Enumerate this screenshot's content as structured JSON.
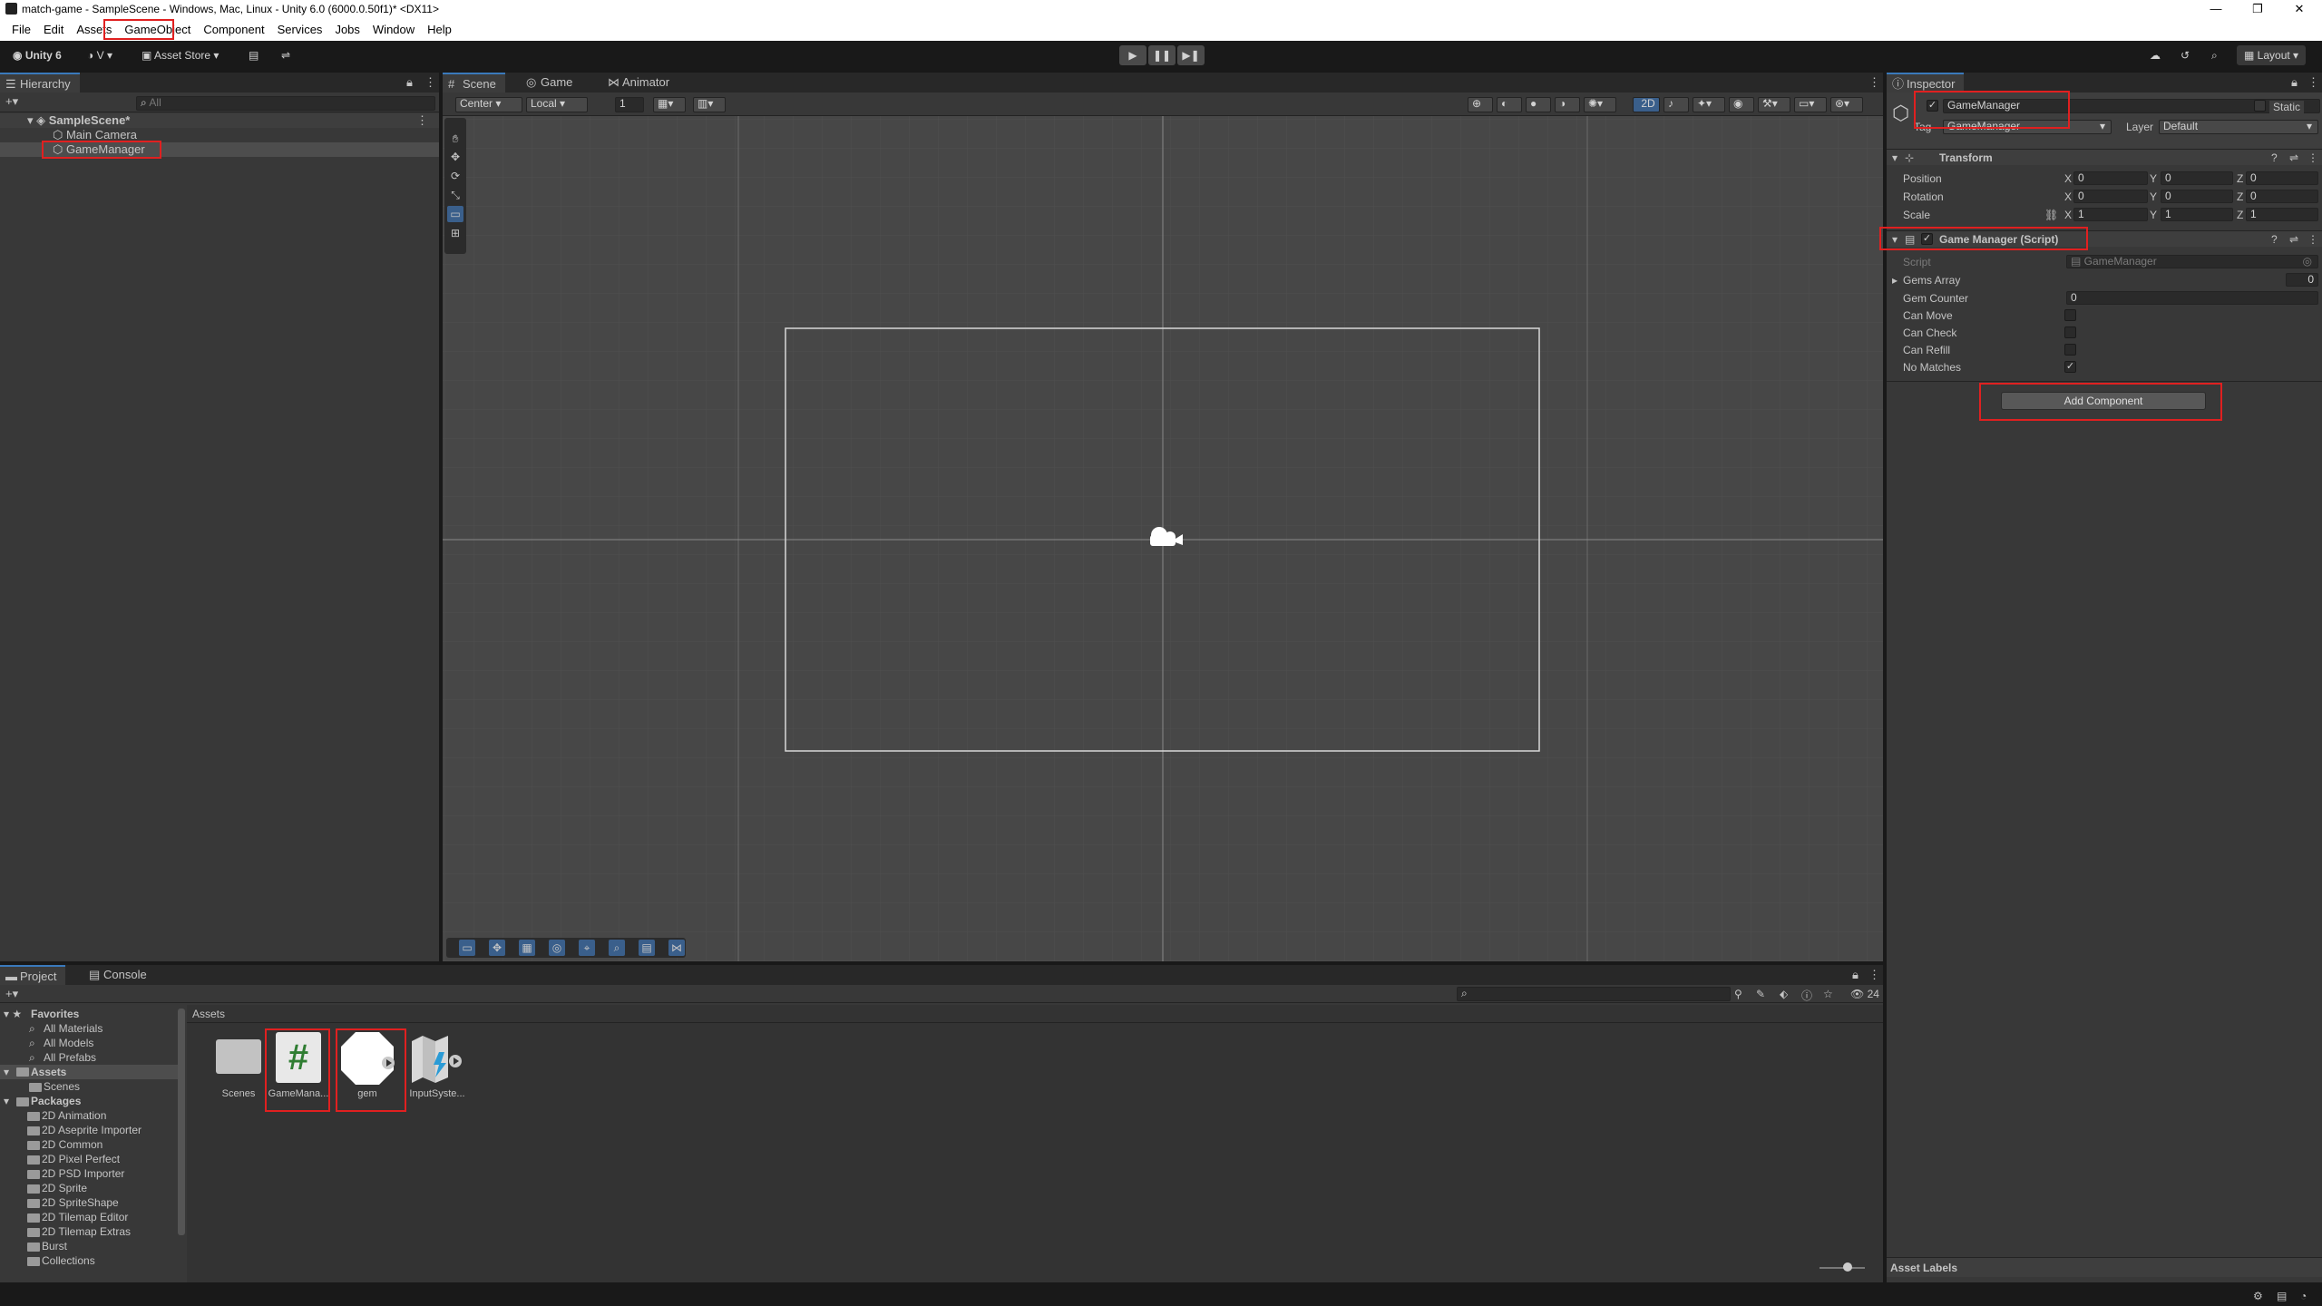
{
  "window": {
    "title": "match-game - SampleScene - Windows, Mac, Linux - Unity 6.0 (6000.0.50f1)* <DX11>"
  },
  "menu": [
    "File",
    "Edit",
    "Assets",
    "GameObject",
    "Component",
    "Services",
    "Jobs",
    "Window",
    "Help"
  ],
  "toolbar": {
    "unity_label": "Unity 6",
    "account_label": "V",
    "asset_store_label": "Asset Store",
    "layout_label": "Layout"
  },
  "hierarchy": {
    "tab_label": "Hierarchy",
    "search_placeholder": "All",
    "scene": "SampleScene*",
    "items": [
      "Main Camera",
      "GameManager"
    ]
  },
  "scene_view": {
    "tabs": [
      "Scene",
      "Game",
      "Animator"
    ],
    "pivot_label": "Center",
    "space_label": "Local",
    "grid_value": "1",
    "mode_2d": "2D"
  },
  "inspector": {
    "tab_label": "Inspector",
    "object_name": "GameManager",
    "static_label": "Static",
    "tag_label": "Tag",
    "tag_value": "GameManager",
    "layer_label": "Layer",
    "layer_value": "Default",
    "transform": {
      "title": "Transform",
      "position_label": "Position",
      "rotation_label": "Rotation",
      "scale_label": "Scale",
      "x": "X",
      "y": "Y",
      "z": "Z",
      "position": [
        "0",
        "0",
        "0"
      ],
      "rotation": [
        "0",
        "0",
        "0"
      ],
      "scale": [
        "1",
        "1",
        "1"
      ]
    },
    "script_component": {
      "title": "Game Manager (Script)",
      "script_label": "Script",
      "script_value": "GameManager",
      "gems_array_label": "Gems Array",
      "gems_array_value": "0",
      "gem_counter_label": "Gem Counter",
      "gem_counter_value": "0",
      "can_move_label": "Can Move",
      "can_check_label": "Can Check",
      "can_refill_label": "Can Refill",
      "no_matches_label": "No Matches",
      "no_matches_checked": "✓"
    },
    "add_component_label": "Add Component",
    "asset_labels": "Asset Labels"
  },
  "project": {
    "tabs": [
      "Project",
      "Console"
    ],
    "favorites_label": "Favorites",
    "favorites": [
      "All Materials",
      "All Models",
      "All Prefabs"
    ],
    "assets_label": "Assets",
    "scenes_label": "Scenes",
    "packages_label": "Packages",
    "packages": [
      "2D Animation",
      "2D Aseprite Importer",
      "2D Common",
      "2D Pixel Perfect",
      "2D PSD Importer",
      "2D Sprite",
      "2D SpriteShape",
      "2D Tilemap Editor",
      "2D Tilemap Extras",
      "Burst",
      "Collections"
    ],
    "breadcrumb": "Assets",
    "hidden_count": "24",
    "asset_items": [
      "Scenes",
      "GameMana...",
      "gem",
      "InputSyste..."
    ],
    "script_glyph": "#"
  },
  "colors": {
    "accent": "#3a79bb",
    "highlight": "#e02020",
    "panel": "#383838"
  }
}
